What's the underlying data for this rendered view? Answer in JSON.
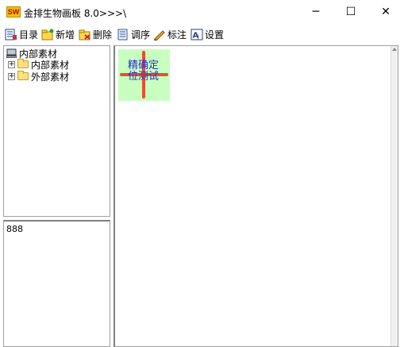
{
  "window": {
    "icon_text": "SW",
    "title": "金排生物画板 8.0>>>\\",
    "minimize_glyph": "─",
    "maximize_glyph": "☐",
    "close_glyph": "✕"
  },
  "toolbar": {
    "items": [
      {
        "label": "目录",
        "icon": "catalog-icon"
      },
      {
        "label": "新增",
        "icon": "new-folder-icon"
      },
      {
        "label": "删除",
        "icon": "delete-folder-icon"
      },
      {
        "label": "调序",
        "icon": "reorder-icon"
      },
      {
        "label": "标注",
        "icon": "pencil-icon"
      },
      {
        "label": "设置",
        "icon": "settings-icon"
      }
    ]
  },
  "tree": {
    "root": {
      "label": "内部素材",
      "icon": "computer-icon"
    },
    "children": [
      {
        "label": "内部素材",
        "expander": "+"
      },
      {
        "label": "外部素材",
        "expander": "+"
      }
    ]
  },
  "props": {
    "value": "888"
  },
  "canvas": {
    "item_text": "精确定\n位测试",
    "colors": {
      "background": "#c8ffc0",
      "cross": "#e85030",
      "text": "#2a2ad0"
    }
  }
}
